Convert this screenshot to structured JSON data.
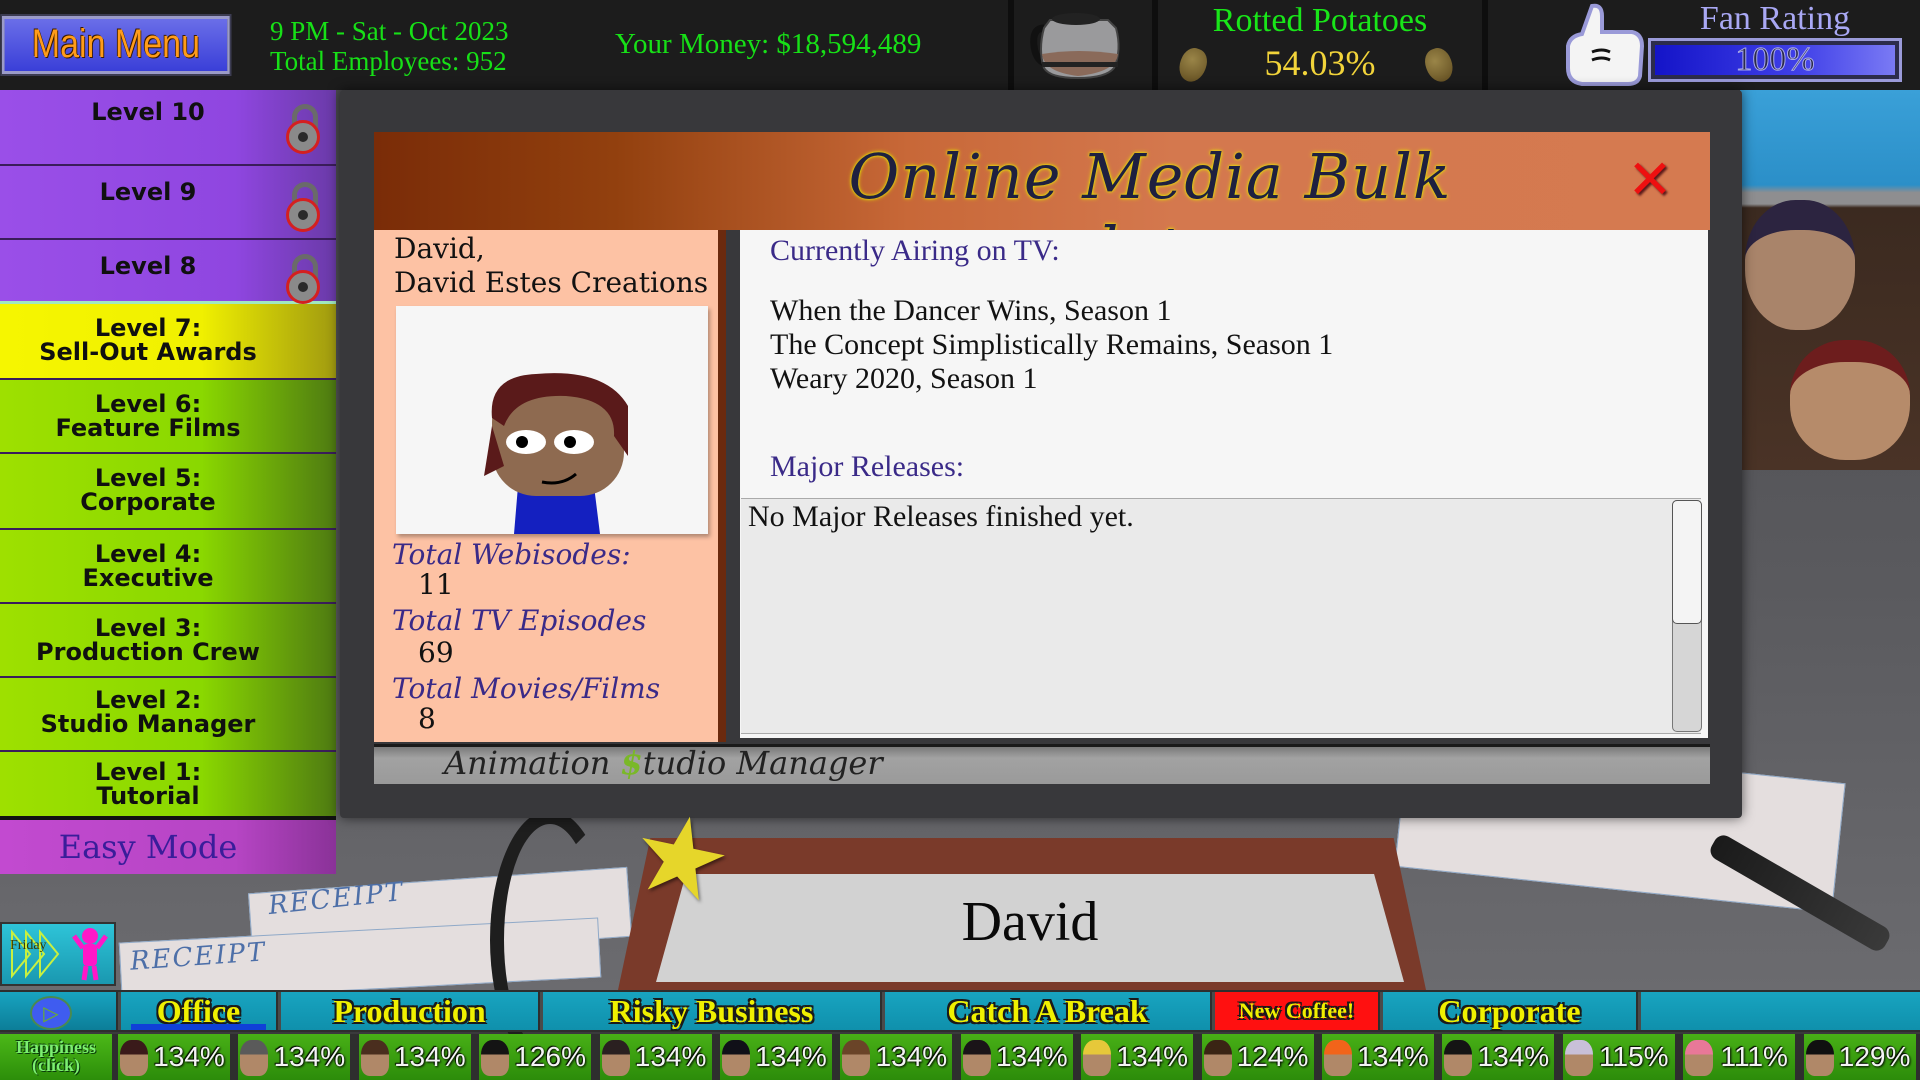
{
  "topbar": {
    "main_menu_label": "Main Menu",
    "time": "9 PM - Sat - Oct 2023",
    "employees": "Total Employees: 952",
    "money": "Your Money: $18,594,489",
    "rotted_potatoes": {
      "title": "Rotted Potatoes",
      "value": "54.03%"
    },
    "fan_rating": {
      "title": "Fan Rating",
      "value": "100%",
      "fill_fraction": 1.0
    },
    "icons": {
      "coffee": "coffee-pot-icon",
      "potato": "potato-icon",
      "thumbs_up": "thumbs-up-icon"
    }
  },
  "sidebar": {
    "levels": [
      {
        "title": "Level 10",
        "subtitle": "",
        "locked": true
      },
      {
        "title": "Level 9",
        "subtitle": "",
        "locked": true
      },
      {
        "title": "Level 8",
        "subtitle": "",
        "locked": true
      },
      {
        "title": "Level 7:",
        "subtitle": "Sell-Out Awards",
        "locked": false
      },
      {
        "title": "Level 6:",
        "subtitle": "Feature Films",
        "locked": false
      },
      {
        "title": "Level 5:",
        "subtitle": "Corporate",
        "locked": false
      },
      {
        "title": "Level 4:",
        "subtitle": "Executive",
        "locked": false
      },
      {
        "title": "Level 3:",
        "subtitle": "Production Crew",
        "locked": false
      },
      {
        "title": "Level 2:",
        "subtitle": "Studio Manager",
        "locked": false
      },
      {
        "title": "Level 1:",
        "subtitle": "Tutorial",
        "locked": false
      }
    ],
    "easy_mode": "Easy Mode"
  },
  "dialog": {
    "title": "Online Media Bulk data",
    "close_label": "✕",
    "profile": {
      "name_line1": "David,",
      "name_line2": "David Estes Creations"
    },
    "stats": [
      {
        "label": "Total Webisodes:",
        "value": "11"
      },
      {
        "label": "Total TV Episodes",
        "value": "69"
      },
      {
        "label": "Total Movies/Films",
        "value": "8"
      }
    ],
    "airing_heading": "Currently Airing on TV:",
    "airing": [
      "When the Dancer Wins, Season 1",
      "The Concept Simplistically Remains, Season 1",
      "Weary 2020, Season 1"
    ],
    "releases_heading": "Major Releases:",
    "releases_text": "No Major Releases finished yet.",
    "footer_brand_pre": "Animation ",
    "footer_brand_dollar": "$",
    "footer_brand_post": "tudio Manager"
  },
  "scene": {
    "name_plate": "David",
    "receipt_label": "RECEIPT",
    "friday_label": "Friday"
  },
  "nav": {
    "tabs": [
      {
        "label": "Office",
        "active": true
      },
      {
        "label": "Production",
        "active": false
      },
      {
        "label": "Risky Business",
        "active": false
      },
      {
        "label": "Catch A Break",
        "active": false
      },
      {
        "label": "New  Coffee!",
        "active": false
      },
      {
        "label": "Corporate",
        "active": false
      }
    ],
    "play_icon": "▷"
  },
  "happiness": {
    "label_line1": "Happiness",
    "label_line2": "(click)",
    "employees": [
      {
        "value": "134%",
        "hair": "#3a1a1a"
      },
      {
        "value": "134%",
        "hair": "#5a5a5a"
      },
      {
        "value": "134%",
        "hair": "#4a2e1e"
      },
      {
        "value": "126%",
        "hair": "#141414"
      },
      {
        "value": "134%",
        "hair": "#2a2020"
      },
      {
        "value": "134%",
        "hair": "#101018"
      },
      {
        "value": "134%",
        "hair": "#6a4428"
      },
      {
        "value": "134%",
        "hair": "#1a1418"
      },
      {
        "value": "134%",
        "hair": "#e6c83a"
      },
      {
        "value": "124%",
        "hair": "#3a2414"
      },
      {
        "value": "134%",
        "hair": "#f2641a"
      },
      {
        "value": "134%",
        "hair": "#141414"
      },
      {
        "value": "115%",
        "hair": "#c8c0d8"
      },
      {
        "value": "111%",
        "hair": "#e87898"
      },
      {
        "value": "129%",
        "hair": "#101010"
      }
    ]
  },
  "colors": {
    "topbar_green": "#17e017",
    "rotted_yellow": "#f2d43a",
    "fan_blue": "#3a3ae0",
    "tab_yellow": "#f0f000",
    "heading_purple": "#3a2a88"
  }
}
